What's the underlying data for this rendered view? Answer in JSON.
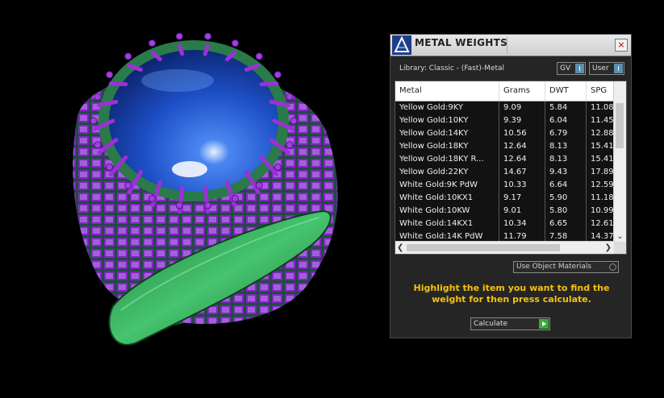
{
  "panel": {
    "title": "METAL WEIGHTS",
    "close_label": "×",
    "library_label": "Library: Classic - (Fast)-Metal",
    "unit_dropdown": "GV",
    "source_dropdown": "User",
    "use_object_materials_label": "Use Object Materials",
    "instruction": "Highlight the item you want to find the weight for then press calculate.",
    "calculate_label": "Calculate"
  },
  "table": {
    "headers": [
      "Metal",
      "Grams",
      "DWT",
      "SPG"
    ],
    "rows": [
      [
        "Yellow Gold:9KY",
        "9.09",
        "5.84",
        "11.08"
      ],
      [
        "Yellow Gold:10KY",
        "9.39",
        "6.04",
        "11.45"
      ],
      [
        "Yellow Gold:14KY",
        "10.56",
        "6.79",
        "12.88"
      ],
      [
        "Yellow Gold:18KY",
        "12.64",
        "8.13",
        "15.41"
      ],
      [
        "Yellow Gold:18KY R...",
        "12.64",
        "8.13",
        "15.41"
      ],
      [
        "Yellow Gold:22KY",
        "14.67",
        "9.43",
        "17.89"
      ],
      [
        "White Gold:9K PdW",
        "10.33",
        "6.64",
        "12.59"
      ],
      [
        "White Gold:10KX1",
        "9.17",
        "5.90",
        "11.18"
      ],
      [
        "White Gold:10KW",
        "9.01",
        "5.80",
        "10.99"
      ],
      [
        "White Gold:14KX1",
        "10.34",
        "6.65",
        "12.61"
      ],
      [
        "White Gold:14K PdW",
        "11.79",
        "7.58",
        "14.37"
      ]
    ]
  },
  "colors": {
    "gem": "#1e50c8",
    "prongs": "#9b30d8",
    "band": "#2fa85a",
    "instruction_text": "#f4c20d"
  }
}
